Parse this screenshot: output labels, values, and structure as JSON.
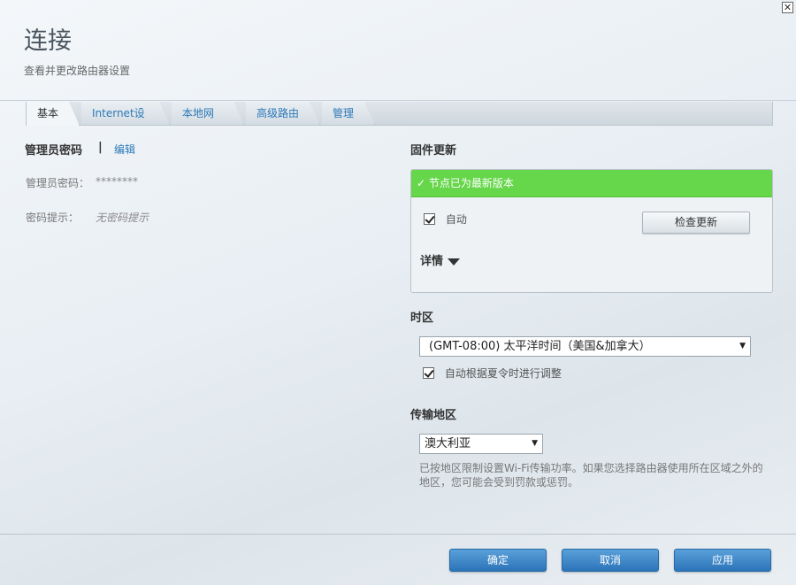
{
  "header": {
    "title": "连接",
    "subtitle": "查看并更改路由器设置",
    "close_glyph": "✕"
  },
  "tabs": [
    {
      "label": "基本",
      "active": true
    },
    {
      "label": "Internet设置",
      "active": false
    },
    {
      "label": "本地网络",
      "active": false
    },
    {
      "label": "高级路由",
      "active": false
    },
    {
      "label": "管理",
      "active": false
    }
  ],
  "admin": {
    "section_title": "管理员密码",
    "separator": "|",
    "edit_link": "编辑",
    "password_label": "管理员密码：",
    "password_value": "********",
    "hint_label": "密码提示：",
    "hint_value": "无密码提示"
  },
  "firmware": {
    "section_title": "固件更新",
    "status_check": "✓",
    "status_text": "节点已为最新版本",
    "auto_label": "自动",
    "auto_checked": true,
    "check_button": "检查更新",
    "details_label": "详情"
  },
  "timezone": {
    "section_title": "时区",
    "selected": "(GMT-08:00)  太平洋时间（美国&加拿大）",
    "dst_label": "自动根据夏令时进行调整",
    "dst_checked": true
  },
  "region": {
    "section_title": "传输地区",
    "selected": "澳大利亚",
    "note": "已按地区限制设置Wi-Fi传输功率。如果您选择路由器使用所在区域之外的地区，您可能会受到罚款或惩罚。"
  },
  "footer": {
    "ok_button": "确定",
    "cancel_button": "取消",
    "apply_button": "应用"
  },
  "colors": {
    "accent": "#2c79b8",
    "success": "#66d64a"
  }
}
